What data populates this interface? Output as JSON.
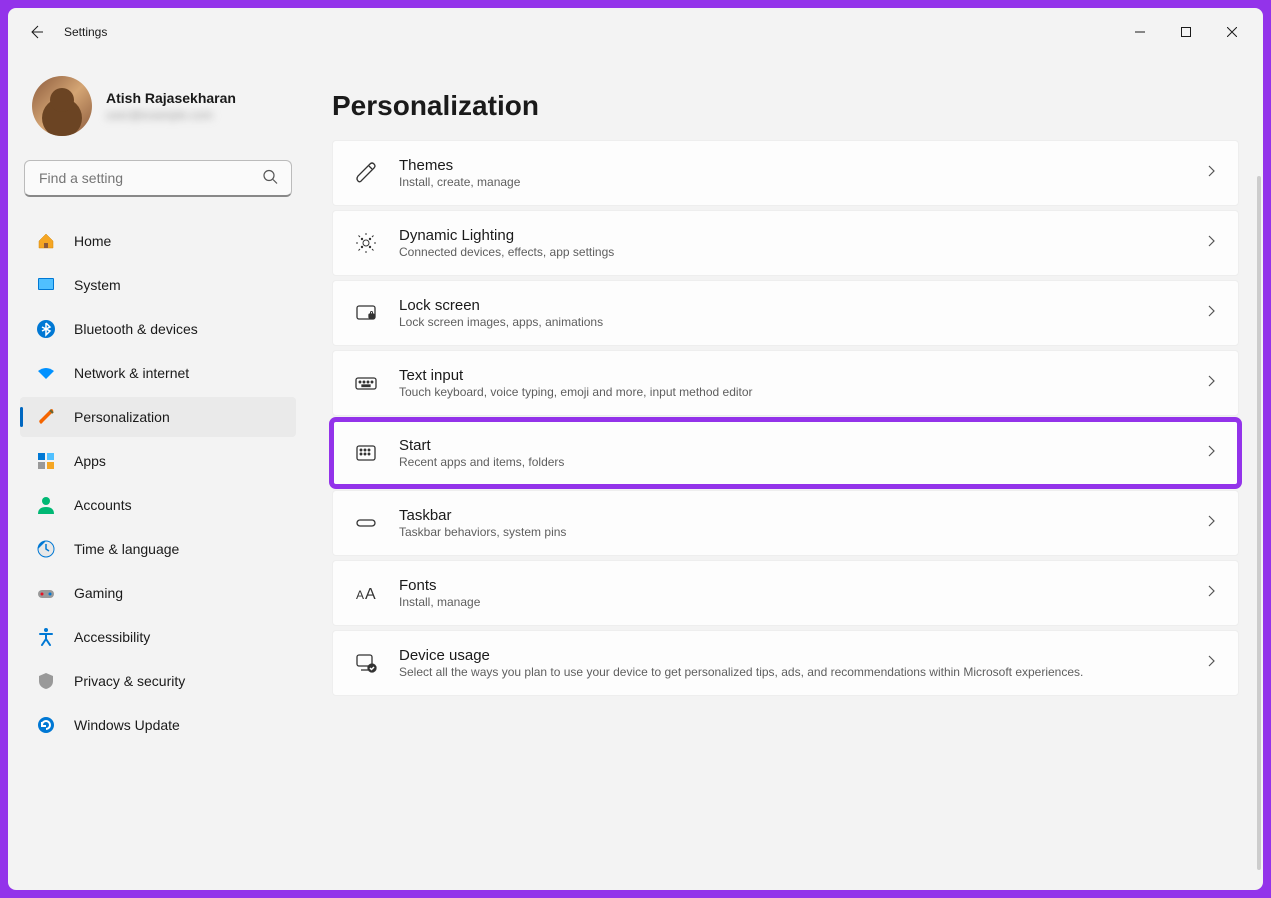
{
  "window": {
    "title": "Settings"
  },
  "user": {
    "name": "Atish Rajasekharan",
    "email": "user@example.com"
  },
  "search": {
    "placeholder": "Find a setting"
  },
  "nav": {
    "items": [
      {
        "label": "Home"
      },
      {
        "label": "System"
      },
      {
        "label": "Bluetooth & devices"
      },
      {
        "label": "Network & internet"
      },
      {
        "label": "Personalization"
      },
      {
        "label": "Apps"
      },
      {
        "label": "Accounts"
      },
      {
        "label": "Time & language"
      },
      {
        "label": "Gaming"
      },
      {
        "label": "Accessibility"
      },
      {
        "label": "Privacy & security"
      },
      {
        "label": "Windows Update"
      }
    ]
  },
  "page": {
    "title": "Personalization"
  },
  "cards": [
    {
      "title": "Themes",
      "sub": "Install, create, manage"
    },
    {
      "title": "Dynamic Lighting",
      "sub": "Connected devices, effects, app settings"
    },
    {
      "title": "Lock screen",
      "sub": "Lock screen images, apps, animations"
    },
    {
      "title": "Text input",
      "sub": "Touch keyboard, voice typing, emoji and more, input method editor"
    },
    {
      "title": "Start",
      "sub": "Recent apps and items, folders"
    },
    {
      "title": "Taskbar",
      "sub": "Taskbar behaviors, system pins"
    },
    {
      "title": "Fonts",
      "sub": "Install, manage"
    },
    {
      "title": "Device usage",
      "sub": "Select all the ways you plan to use your device to get personalized tips, ads, and recommendations within Microsoft experiences."
    }
  ]
}
